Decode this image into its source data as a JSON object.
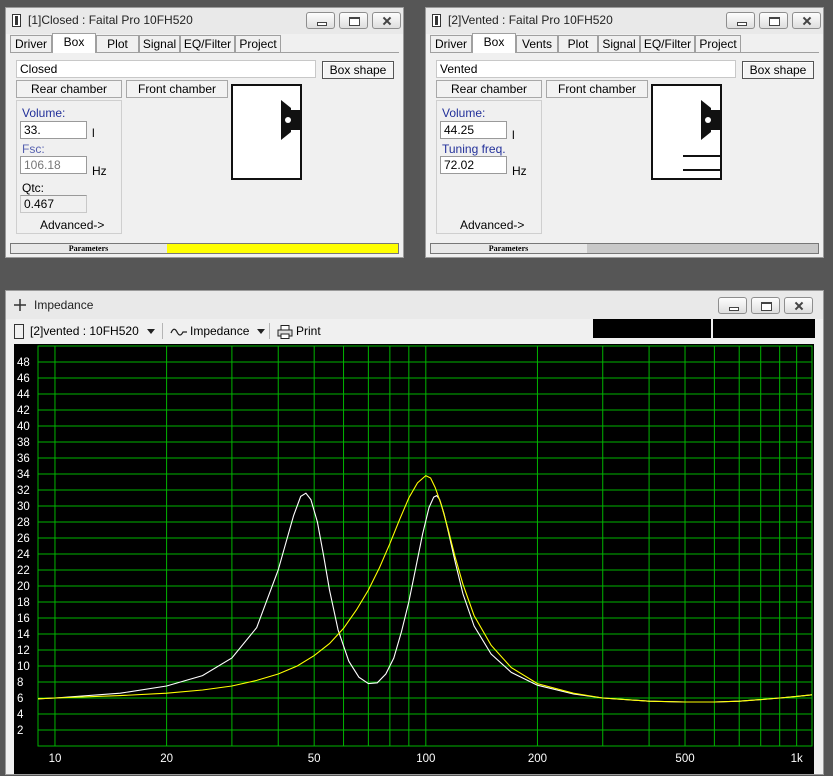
{
  "closed_window": {
    "title": "[1]Closed : Faital Pro 10FH520",
    "tabs": [
      {
        "label": "Driver"
      },
      {
        "label": "Box"
      },
      {
        "label": "Plot"
      },
      {
        "label": "Signal"
      },
      {
        "label": "EQ/Filter"
      },
      {
        "label": "Project"
      }
    ],
    "box_type": "Closed",
    "box_shape_button": "Box shape",
    "rear_chamber_button": "Rear chamber",
    "front_chamber_button": "Front chamber",
    "volume_label": "Volume:",
    "volume_value": "33.",
    "volume_unit": "l",
    "fsc_label": "Fsc:",
    "fsc_value": "106.18",
    "fsc_unit": "Hz",
    "qtc_label": "Qtc:",
    "qtc_value": "0.467",
    "advanced_link": "Advanced->",
    "status_label": "Parameters",
    "status_color": "#ffff00"
  },
  "vented_window": {
    "title": "[2]Vented : Faital Pro 10FH520",
    "tabs": [
      {
        "label": "Driver"
      },
      {
        "label": "Box"
      },
      {
        "label": "Vents"
      },
      {
        "label": "Plot"
      },
      {
        "label": "Signal"
      },
      {
        "label": "EQ/Filter"
      },
      {
        "label": "Project"
      }
    ],
    "box_type": "Vented",
    "box_shape_button": "Box shape",
    "rear_chamber_button": "Rear chamber",
    "front_chamber_button": "Front chamber",
    "volume_label": "Volume:",
    "volume_value": "44.25",
    "volume_unit": "l",
    "tuning_label": "Tuning freq.",
    "tuning_value": "72.02",
    "tuning_unit": "Hz",
    "advanced_link": "Advanced->",
    "status_label": "Parameters",
    "status_color": "#c8c8c8"
  },
  "impedance_window": {
    "title": "Impedance",
    "project_select": "[2]vented : 10FH520",
    "plot_select": "Impedance",
    "print_button": "Print"
  },
  "chart_data": {
    "type": "line",
    "title": "",
    "xlabel": "",
    "ylabel": "",
    "x_scale": "log",
    "xlim": [
      9,
      1100
    ],
    "ylim": [
      0,
      50
    ],
    "x_ticks": [
      {
        "v": 10,
        "label": "10"
      },
      {
        "v": 20,
        "label": "20"
      },
      {
        "v": 50,
        "label": "50"
      },
      {
        "v": 100,
        "label": "100"
      },
      {
        "v": 200,
        "label": "200"
      },
      {
        "v": 500,
        "label": "500"
      },
      {
        "v": 1000,
        "label": "1k"
      }
    ],
    "y_ticks": [
      "2",
      "4",
      "6",
      "8",
      "10",
      "12",
      "14",
      "16",
      "18",
      "20",
      "22",
      "24",
      "26",
      "28",
      "30",
      "32",
      "34",
      "36",
      "38",
      "40",
      "42",
      "44",
      "46",
      "48"
    ],
    "grid": true,
    "grid_color": "#00b400",
    "background": "#000000",
    "series": [
      {
        "color": "#ffffff",
        "x": [
          9,
          10,
          15,
          20,
          25,
          30,
          35,
          40,
          42,
          44,
          46,
          47.5,
          49,
          51,
          53,
          55,
          58,
          62,
          66,
          70,
          74,
          78,
          82,
          86,
          90,
          94,
          98,
          102,
          105,
          107,
          109,
          112,
          115,
          120,
          126,
          135,
          150,
          170,
          200,
          250,
          300,
          400,
          500,
          600,
          700,
          800,
          900,
          1000,
          1100
        ],
        "y": [
          5.9,
          6.0,
          6.6,
          7.5,
          8.8,
          11.0,
          14.8,
          22.0,
          25.5,
          28.8,
          31.2,
          31.6,
          30.8,
          28.0,
          23.8,
          19.5,
          14.5,
          10.6,
          8.6,
          7.8,
          7.9,
          9.0,
          11.0,
          14.3,
          18.0,
          22.3,
          26.5,
          29.8,
          31.1,
          31.3,
          30.8,
          29.0,
          26.8,
          23.0,
          19.0,
          15.0,
          11.5,
          9.2,
          7.6,
          6.5,
          6.0,
          5.6,
          5.5,
          5.5,
          5.6,
          5.8,
          6.0,
          6.2,
          6.4
        ]
      },
      {
        "color": "#ffff00",
        "x": [
          9,
          10,
          15,
          20,
          25,
          30,
          35,
          40,
          45,
          50,
          55,
          60,
          65,
          70,
          75,
          80,
          85,
          90,
          95,
          100,
          103,
          106,
          110,
          115,
          120,
          126,
          135,
          150,
          170,
          200,
          250,
          300,
          400,
          500,
          600,
          700,
          800,
          900,
          1000,
          1100
        ],
        "y": [
          5.9,
          6.0,
          6.3,
          6.6,
          7.0,
          7.5,
          8.2,
          9.0,
          10.0,
          11.3,
          12.8,
          14.7,
          17.0,
          19.5,
          22.3,
          25.3,
          28.3,
          31.0,
          32.9,
          33.8,
          33.5,
          32.3,
          30.2,
          27.0,
          23.6,
          20.2,
          16.3,
          12.6,
          9.8,
          7.8,
          6.6,
          6.0,
          5.6,
          5.5,
          5.5,
          5.6,
          5.8,
          6.0,
          6.2,
          6.4
        ]
      }
    ]
  }
}
